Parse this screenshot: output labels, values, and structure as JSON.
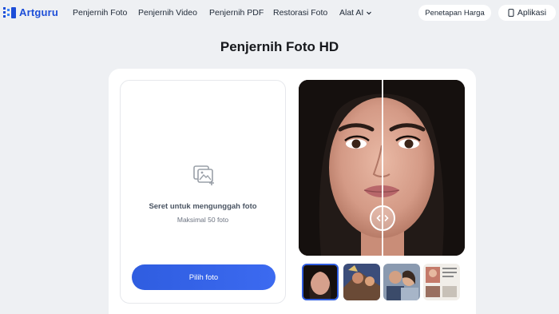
{
  "brand": {
    "name": "Artguru"
  },
  "nav": {
    "links": [
      "Penjernih Foto",
      "Penjernih Video",
      "Penjernih PDF",
      "Restorasi Foto",
      "Alat AI"
    ],
    "pricing": "Penetapan Harga",
    "app": "Aplikasi"
  },
  "page": {
    "title": "Penjernih Foto HD"
  },
  "upload": {
    "drag_text": "Seret untuk mengunggah foto",
    "limit_text": "Maksimal 50 foto",
    "button": "Pilih foto"
  },
  "icons": {
    "logo": "artguru-logo-icon",
    "dropdown": "chevron-down-icon",
    "app": "phone-icon",
    "upload": "image-add-icon",
    "compare": "compare-arrows-icon"
  },
  "colors": {
    "brand": "#1d4ed8",
    "button": "#2f5de0",
    "background": "#eef0f3"
  }
}
